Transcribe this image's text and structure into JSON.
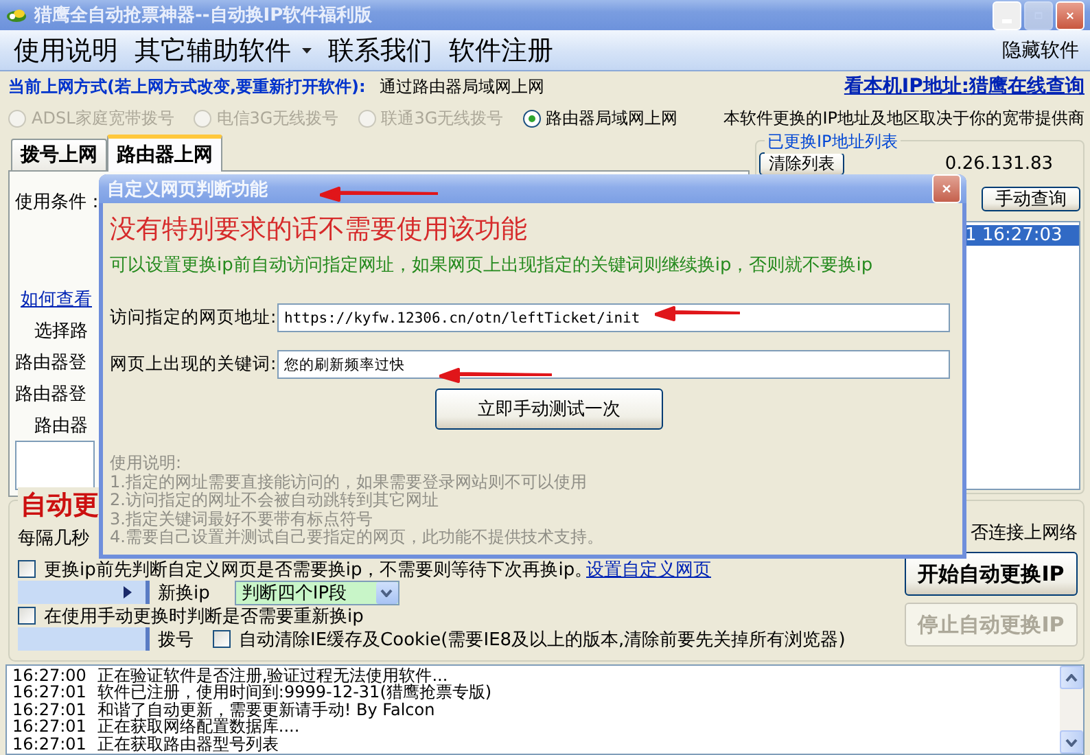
{
  "window": {
    "title": "猎鹰全自动抢票神器--自动换IP软件福利版",
    "buttons": [
      {
        "kind": "minimize",
        "disabled": false
      },
      {
        "kind": "maximize",
        "disabled": true
      },
      {
        "kind": "close",
        "disabled": false
      }
    ]
  },
  "menu": {
    "items": [
      {
        "label": "使用说明",
        "kind": "item"
      },
      {
        "label": "其它辅助软件",
        "kind": "dropdown"
      },
      {
        "label": "联系我们",
        "kind": "item"
      },
      {
        "label": "软件注册",
        "kind": "item"
      }
    ],
    "hide": "隐藏软件"
  },
  "connection": {
    "label": "当前上网方式(若上网方式改变,要重新打开软件):",
    "value": "通过路由器局域网上网",
    "ip_link": "看本机IP地址:猎鹰在线查询"
  },
  "modes": [
    {
      "label": "ADSL家庭宽带拨号",
      "selected": false,
      "disabled": true
    },
    {
      "label": "电信3G无线拨号",
      "selected": false,
      "disabled": true
    },
    {
      "label": "联通3G无线拨号",
      "selected": false,
      "disabled": true
    },
    {
      "label": "路由器局域网上网",
      "selected": true,
      "disabled": false
    }
  ],
  "provider_note": "本软件更换的IP地址及地区取决于你的宽带提供商",
  "tabs": [
    {
      "label": "拨号上网",
      "selected": false
    },
    {
      "label": "路由器上网",
      "selected": true
    }
  ],
  "router_panel": [
    {
      "kind": "text",
      "text": "使用条件："
    },
    {
      "kind": "link",
      "text": "如何查看"
    },
    {
      "kind": "sub",
      "text": "选择路"
    },
    {
      "kind": "text",
      "text": "路由器登"
    },
    {
      "kind": "text",
      "text": "路由器登"
    },
    {
      "kind": "sub",
      "text": "路由器"
    }
  ],
  "ip_list": {
    "title": "已更换IP地址列表",
    "clear_button": "清除列表",
    "current_ip": "0.26.131.83",
    "query_button": "手动查询",
    "rows": [
      {
        "text": "1 16:27:03",
        "selected": true
      }
    ]
  },
  "auto": {
    "title": "自动更",
    "interval_label": "每隔几秒",
    "network_note": "否连接上网络",
    "precheck": {
      "label": "更换ip前先判断自定义网页是否需要换ip，不需要则等待下次再换ip。",
      "checked": false
    },
    "custom_link": "设置自定义网页",
    "renew_label": "新换ip",
    "mode_combo": "判断四个IP段",
    "manual_check": {
      "label": "在使用手动更换时判断是否需要重新换ip",
      "checked": false
    },
    "dial_label": "拨号",
    "clear_cache": {
      "label": "自动清除IE缓存及Cookie(需要IE8及以上的版本,清除前要先关掉所有浏览器)",
      "checked": false
    },
    "start_button": {
      "label": "开始自动更换IP",
      "disabled": false
    },
    "stop_button": {
      "label": "停止自动更换IP",
      "disabled": true
    }
  },
  "log": [
    {
      "time": "16:27:00",
      "message": "正在验证软件是否注册,验证过程无法使用软件..."
    },
    {
      "time": "16:27:01",
      "message": "软件已注册，使用时间到:9999-12-31(猎鹰抢票专版)"
    },
    {
      "time": "16:27:01",
      "message": "和谐了自动更新，需要更新请手动! By Falcon"
    },
    {
      "time": "16:27:01",
      "message": "正在获取网络配置数据库...."
    },
    {
      "time": "16:27:01",
      "message": "正在获取路由器型号列表"
    }
  ],
  "dialog": {
    "title": "自定义网页判断功能",
    "warning": "没有特别要求的话不需要使用该功能",
    "description": "可以设置更换ip前自动访问指定网址，如果网页上出现指定的关键词则继续换ip，否则就不要换ip",
    "fields": [
      {
        "label": "访问指定的网页地址:",
        "value": "https://kyfw.12306.cn/otn/leftTicket/init"
      },
      {
        "label": "网页上出现的关键词:",
        "value": "您的刷新频率过快"
      }
    ],
    "test_button": "立即手动测试一次",
    "notes": [
      "使用说明:",
      "1.指定的网址需要直接能访问的，如果需要登录网站则不可以使用",
      "2.访问指定的网址不会被自动跳转到其它网址",
      "3.指定关键词最好不要带有标点符号",
      "4.需要自己设置并测试自己要指定的网页，此功能不提供技术支持。"
    ]
  }
}
